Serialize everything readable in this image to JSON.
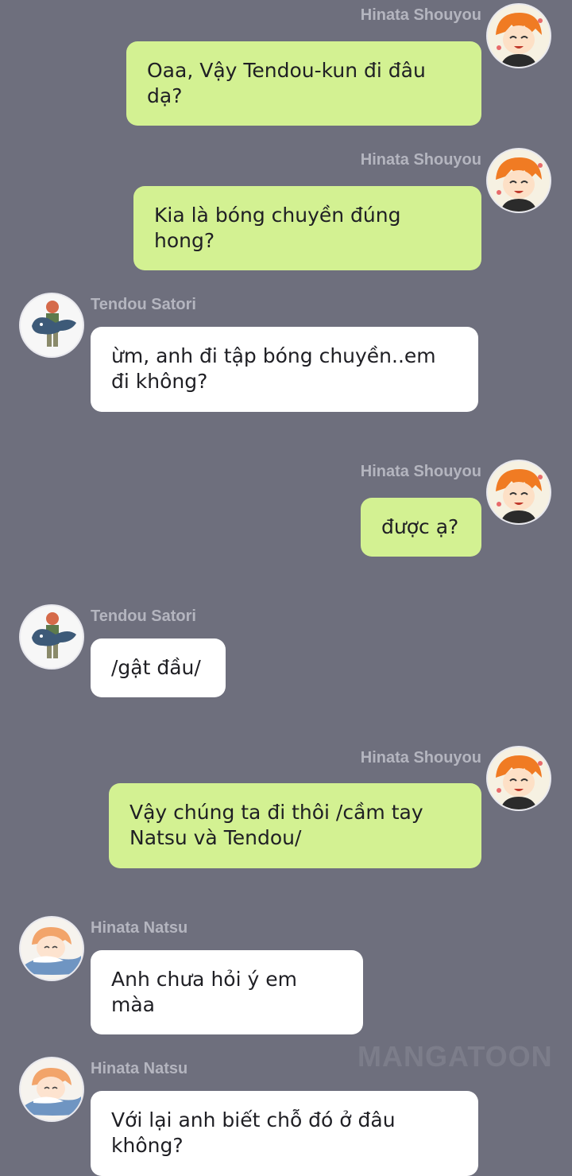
{
  "watermark": "MANGATOON",
  "messages": [
    {
      "side": "right",
      "sender": "Hinata Shouyou",
      "avatar": "hinata-shouyou-avatar",
      "text": "Oaa, Vậy Tendou-kun đi đâu dạ?"
    },
    {
      "side": "right",
      "sender": "Hinata Shouyou",
      "avatar": "hinata-shouyou-avatar",
      "text": "Kia là bóng chuyền đúng hong?"
    },
    {
      "side": "left",
      "sender": "Tendou Satori",
      "avatar": "tendou-satori-avatar",
      "text": "ừm, anh đi tập bóng chuyền..em đi không?"
    },
    {
      "side": "right",
      "sender": "Hinata Shouyou",
      "avatar": "hinata-shouyou-avatar",
      "text": "được ạ?"
    },
    {
      "side": "left",
      "sender": "Tendou Satori",
      "avatar": "tendou-satori-avatar",
      "text": "/gật đầu/"
    },
    {
      "side": "right",
      "sender": "Hinata Shouyou",
      "avatar": "hinata-shouyou-avatar",
      "text": "Vậy chúng ta đi thôi /cầm tay Natsu và Tendou/"
    },
    {
      "side": "left",
      "sender": "Hinata Natsu",
      "avatar": "hinata-natsu-avatar",
      "text": "Anh chưa hỏi ý em màa"
    },
    {
      "side": "left",
      "sender": "Hinata Natsu",
      "avatar": "hinata-natsu-avatar",
      "text": "Với lại anh biết chỗ đó ở đâu không?"
    }
  ]
}
